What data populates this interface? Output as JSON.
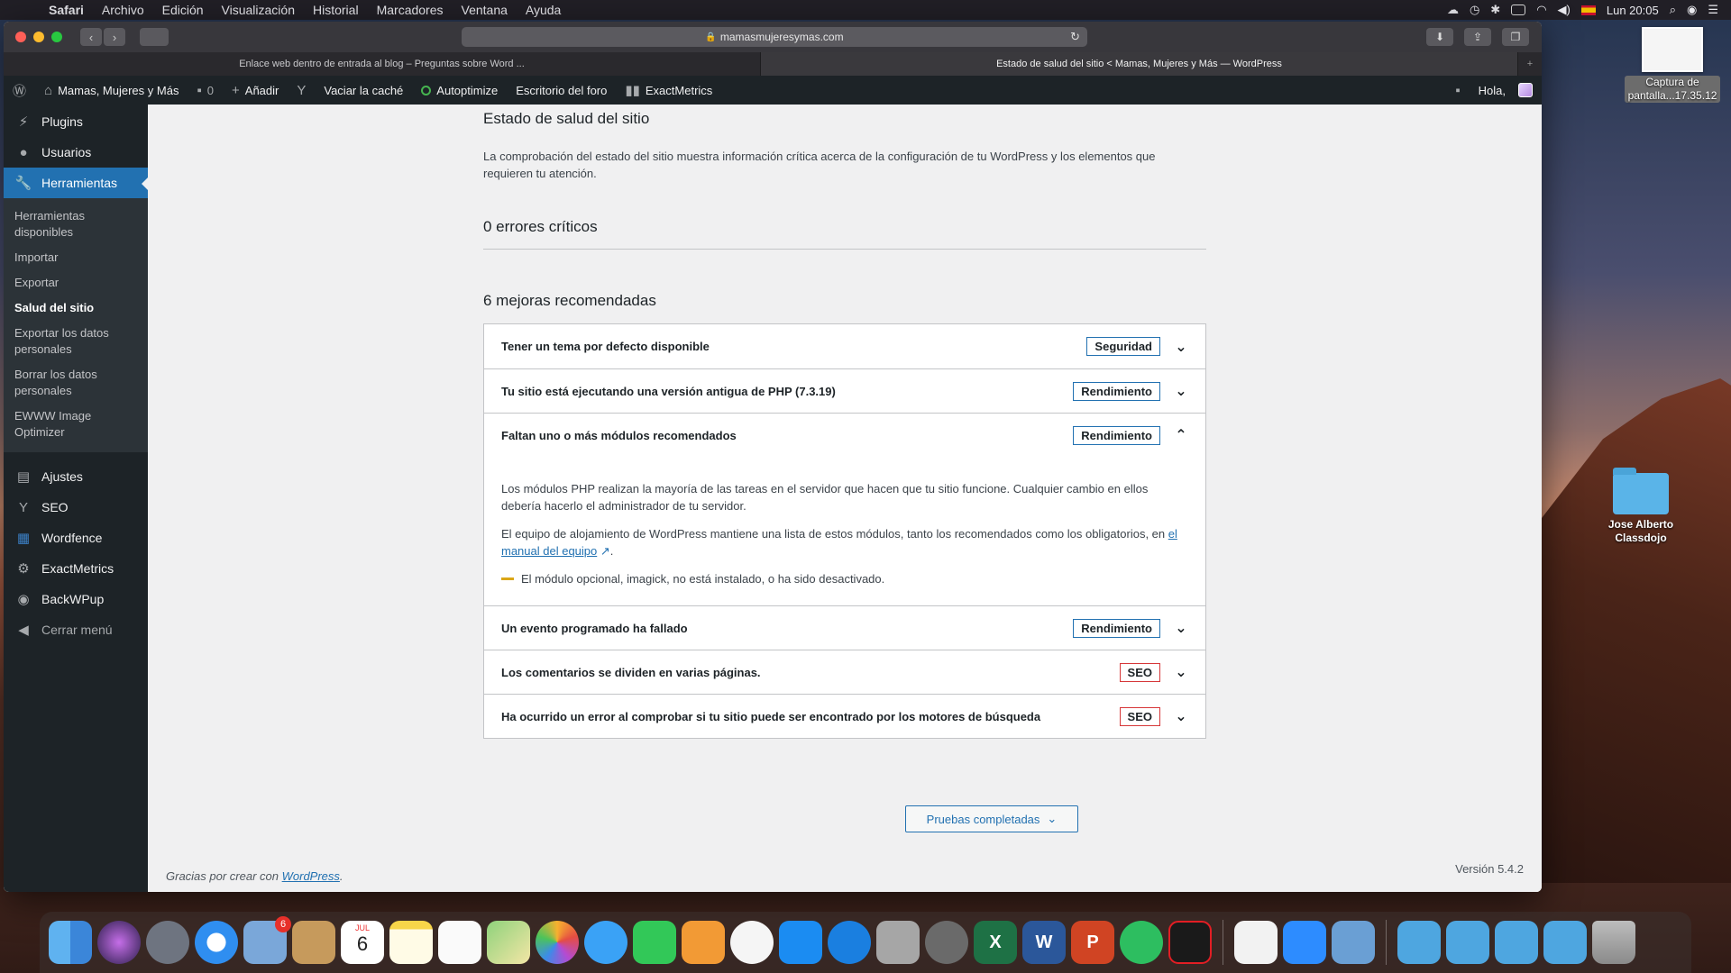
{
  "menubar": {
    "app": "Safari",
    "items": [
      "Archivo",
      "Edición",
      "Visualización",
      "Historial",
      "Marcadores",
      "Ventana",
      "Ayuda"
    ],
    "clock": "Lun 20:05"
  },
  "browser": {
    "url": "mamasmujeresymas.com",
    "tabs": [
      {
        "title": "Enlace web dentro de entrada al blog – Preguntas sobre Word ..."
      },
      {
        "title": "Estado de salud del sitio < Mamas, Mujeres y Más — WordPress"
      }
    ]
  },
  "adminbar": {
    "site_name": "Mamas, Mujeres y Más",
    "comments_count": "0",
    "add_new": "Añadir",
    "clear_cache": "Vaciar la caché",
    "autoptimize": "Autoptimize",
    "forum_desk": "Escritorio del foro",
    "exactmetrics": "ExactMetrics",
    "greeting": "Hola,"
  },
  "sidebar": {
    "items_top": [
      "Plugins",
      "Usuarios"
    ],
    "current": "Herramientas",
    "submenu": [
      "Herramientas disponibles",
      "Importar",
      "Exportar",
      "Salud del sitio",
      "Exportar los datos personales",
      "Borrar los datos personales",
      "EWWW Image Optimizer"
    ],
    "items_bottom": [
      "Ajustes",
      "SEO",
      "Wordfence",
      "ExactMetrics",
      "BackWPup"
    ],
    "collapse": "Cerrar menú"
  },
  "page": {
    "title": "Estado de salud del sitio",
    "intro": "La comprobación del estado del sitio muestra información crítica acerca de la configuración de tu WordPress y los elementos que requieren tu atención.",
    "critical_heading": "0 errores críticos",
    "recommended_heading": "6 mejoras recomendadas",
    "issues": [
      {
        "title": "Tener un tema por defecto disponible",
        "badge": "Seguridad"
      },
      {
        "title": "Tu sitio está ejecutando una versión antigua de PHP (7.3.19)",
        "badge": "Rendimiento"
      },
      {
        "title": "Faltan uno o más módulos recomendados",
        "badge": "Rendimiento"
      },
      {
        "title": "Un evento programado ha fallado",
        "badge": "Rendimiento"
      },
      {
        "title": "Los comentarios se dividen en varias páginas.",
        "badge": "SEO"
      },
      {
        "title": "Ha ocurrido un error al comprobar si tu sitio puede ser encontrado por los motores de búsqueda",
        "badge": "SEO"
      }
    ],
    "expanded": {
      "p1": "Los módulos PHP realizan la mayoría de las tareas en el servidor que hacen que tu sitio funcione. Cualquier cambio en ellos debería hacerlo el administrador de tu servidor.",
      "p2_before": "El equipo de alojamiento de WordPress mantiene una lista de estos módulos, tanto los recomendados como los obligatorios, en",
      "p2_link": "el manual del equipo",
      "p2_after": ".",
      "warning": "El módulo opcional, imagick, no está instalado, o ha sido desactivado."
    },
    "tests_button": "Pruebas completadas",
    "footer_thanks": "Gracias por crear con",
    "footer_link": "WordPress",
    "version": "Versión 5.4.2"
  },
  "desktop": {
    "screenshot_label_1": "Captura de",
    "screenshot_label_2": "pantalla...17.35.12",
    "folder_label_1": "Jose Alberto",
    "folder_label_2": "Classdojo"
  },
  "dock": {
    "mail_badge": "6",
    "calendar_month": "JUL",
    "calendar_day": "6"
  },
  "colors": {
    "wp_blue": "#2271b1",
    "wp_dark": "#1d2327",
    "seo_red": "#d63638"
  }
}
